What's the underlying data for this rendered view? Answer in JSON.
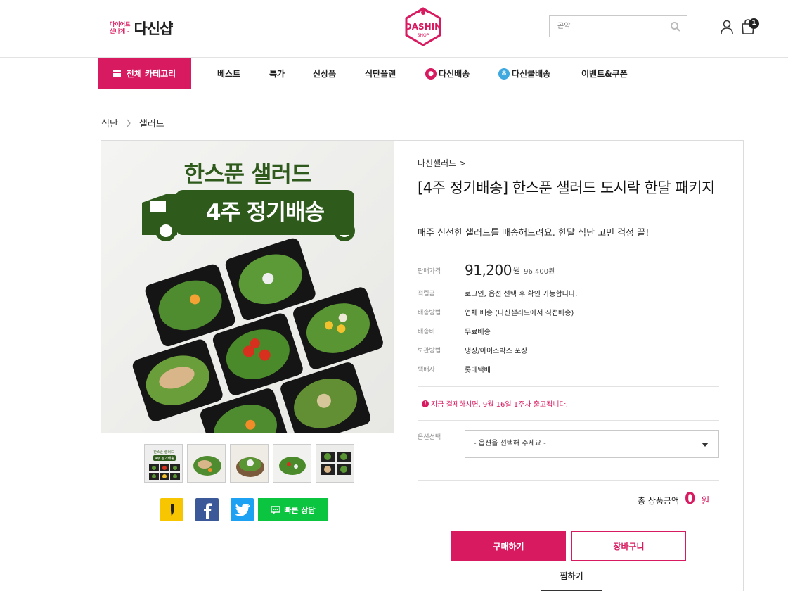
{
  "header": {
    "brand_small_line1": "다이어트",
    "brand_small_line2": "신나게 -",
    "brand_name": "다신샵",
    "logo_text": "DASHIN",
    "logo_sub": "SHOP",
    "search_placeholder": "곤약",
    "cart_count": "1"
  },
  "nav": {
    "category_label": "전체 카테고리",
    "items": [
      {
        "label": "베스트"
      },
      {
        "label": "특가"
      },
      {
        "label": "신상품"
      },
      {
        "label": "식단플랜"
      },
      {
        "label": "다신배송",
        "icon": "dashin-delivery-icon"
      },
      {
        "label": "다신쿨배송",
        "icon": "snowflake-icon"
      },
      {
        "label": "이벤트&쿠폰"
      }
    ]
  },
  "breadcrumb": {
    "level1": "식단",
    "level2": "샐러드"
  },
  "image": {
    "title_line1": "한스푼 샐러드",
    "title_line2": "4주 정기배송",
    "thumb_caption_1": "한스푼 샐러드",
    "thumb_caption_2": "4주 정기배송"
  },
  "share": {
    "consult_label": "빠른 상담"
  },
  "product": {
    "brand_link": "다신샐러드 >",
    "title": "[4주 정기배송] 한스푼 샐러드 도시락 한달 패키지",
    "subtitle": "매주 신선한 샐러드를 배송해드려요. 한달 식단 고민 걱정 끝!",
    "price_label": "판매가격",
    "price": "91,200",
    "price_unit": "원",
    "original_price": "96,400원",
    "points_label": "적립금",
    "points_value": "로그인, 옵션 선택 후 확인 가능합니다.",
    "ship_method_label": "배송방법",
    "ship_method_value": "업체 배송 (다신샐러드에서 직접배송)",
    "ship_fee_label": "배송비",
    "ship_fee_value": "무료배송",
    "storage_label": "보관방법",
    "storage_value": "냉장/아이스박스 포장",
    "courier_label": "택배사",
    "courier_value": "롯데택배",
    "notice": "지금 결제하시면, 9월 16일 1주차 출고됩니다.",
    "option_label": "옵션선택",
    "option_selected": "- 옵션을 선택해 주세요 -",
    "total_label": "총 상품금액",
    "total_amount": "0",
    "total_unit": "원"
  },
  "buttons": {
    "buy": "구매하기",
    "cart": "장바구니",
    "wish": "찜하기"
  },
  "colors": {
    "accent": "#d81b60",
    "salad_green": "#2e5a1c",
    "consult_green": "#0bc43f"
  }
}
